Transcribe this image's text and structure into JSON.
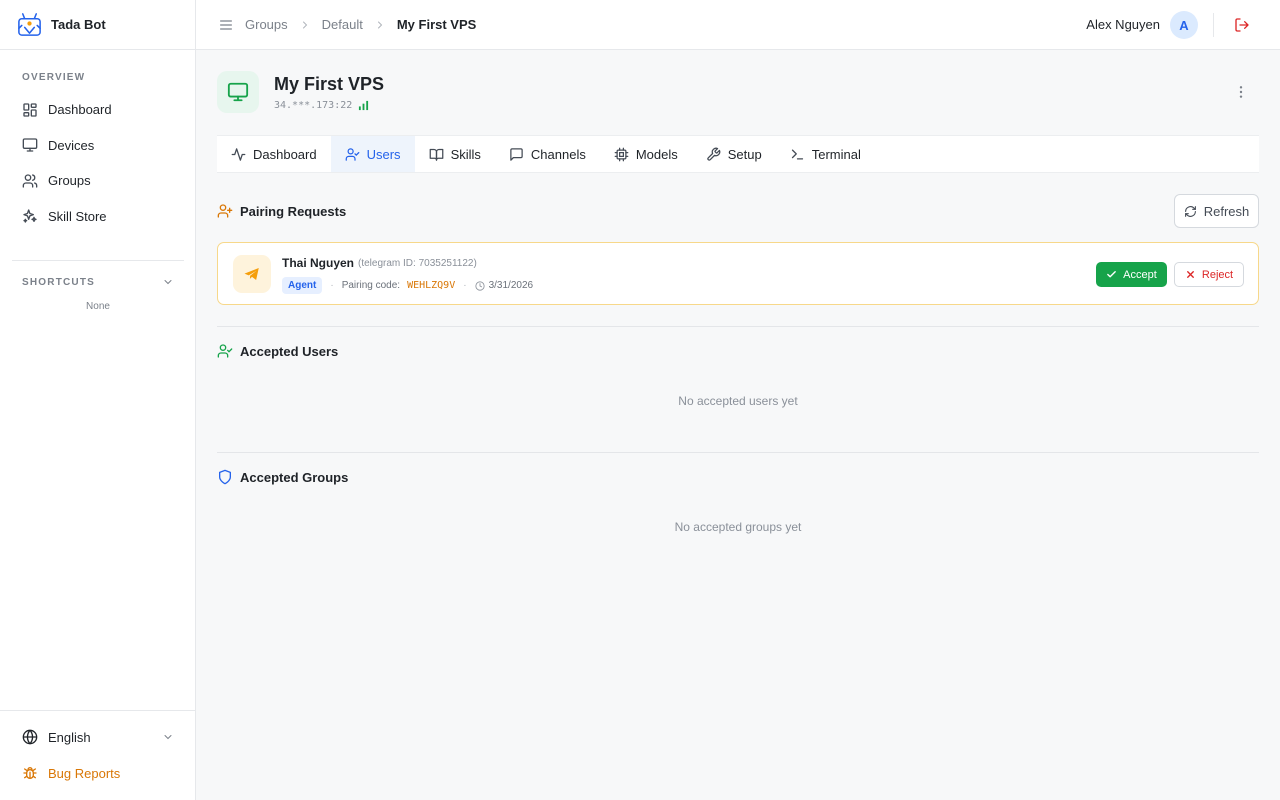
{
  "app": {
    "name": "Tada Bot"
  },
  "sidebar": {
    "overview_label": "OVERVIEW",
    "items": [
      {
        "label": "Dashboard",
        "icon": "dashboard-icon"
      },
      {
        "label": "Devices",
        "icon": "monitor-icon"
      },
      {
        "label": "Groups",
        "icon": "users-icon"
      },
      {
        "label": "Skill Store",
        "icon": "sparkles-icon"
      }
    ],
    "shortcuts_label": "SHORTCUTS",
    "shortcuts_empty": "None",
    "language": "English",
    "bug_reports": "Bug Reports"
  },
  "topbar": {
    "breadcrumbs": [
      "Groups",
      "Default",
      "My First VPS"
    ],
    "user_name": "Alex Nguyen",
    "avatar_initial": "A"
  },
  "device": {
    "name": "My First VPS",
    "ip": "34.***.173:22"
  },
  "tabs": [
    {
      "label": "Dashboard",
      "icon": "activity-icon"
    },
    {
      "label": "Users",
      "icon": "user-check-icon",
      "active": true
    },
    {
      "label": "Skills",
      "icon": "book-icon"
    },
    {
      "label": "Channels",
      "icon": "message-square-icon"
    },
    {
      "label": "Models",
      "icon": "cpu-icon"
    },
    {
      "label": "Setup",
      "icon": "wrench-icon"
    },
    {
      "label": "Terminal",
      "icon": "terminal-icon"
    }
  ],
  "pairing": {
    "title": "Pairing Requests",
    "refresh_label": "Refresh",
    "request": {
      "name": "Thai Nguyen",
      "telegram_id": "(telegram ID: 7035251122)",
      "role": "Agent",
      "code_label": "Pairing code:",
      "code": "WEHLZQ9V",
      "date": "3/31/2026",
      "accept_label": "Accept",
      "reject_label": "Reject"
    }
  },
  "accepted_users": {
    "title": "Accepted Users",
    "empty": "No accepted users yet"
  },
  "accepted_groups": {
    "title": "Accepted Groups",
    "empty": "No accepted groups yet"
  },
  "colors": {
    "accent": "#2563eb",
    "success": "#16a34a",
    "warning": "#d97706",
    "danger": "#dc2626"
  }
}
